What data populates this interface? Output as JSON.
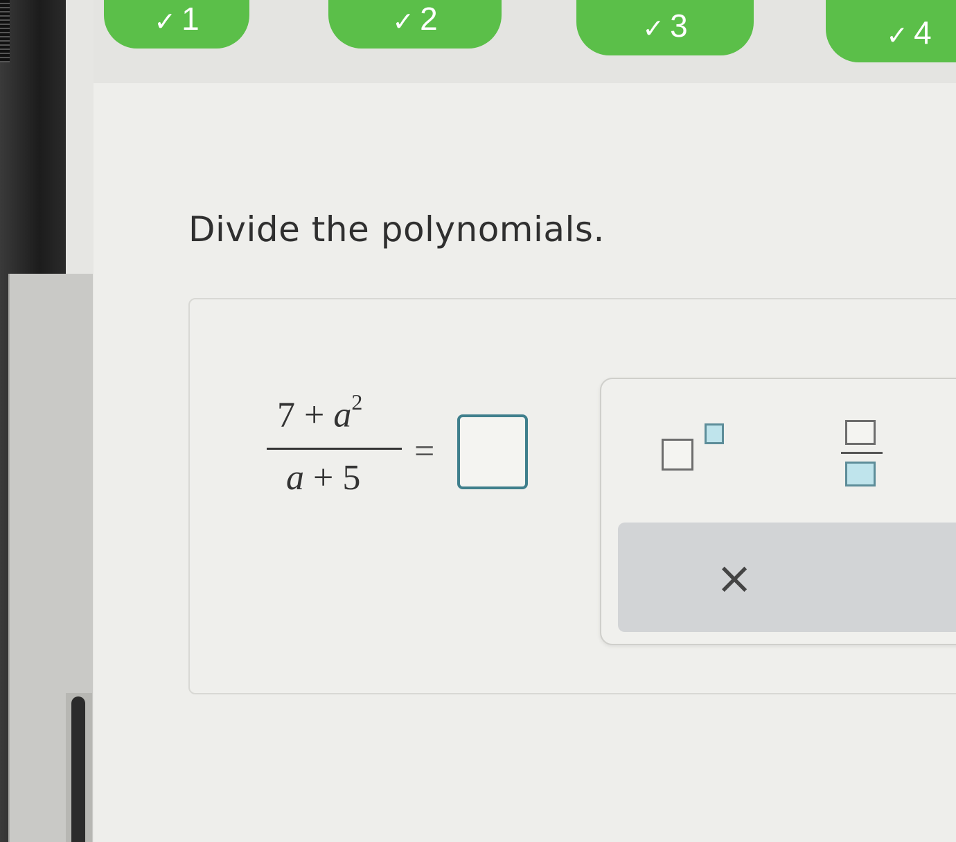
{
  "progress_steps": [
    {
      "label": "1",
      "status": "complete",
      "icon": "checkmark-icon"
    },
    {
      "label": "2",
      "status": "complete",
      "icon": "checkmark-icon"
    },
    {
      "label": "3",
      "status": "complete",
      "icon": "checkmark-icon"
    },
    {
      "label": "4",
      "status": "complete",
      "icon": "checkmark-icon"
    }
  ],
  "colors": {
    "step_complete": "#5bbf49",
    "input_border": "#3f7f8c",
    "placeholder_fill": "#bfe4ec"
  },
  "question": {
    "prompt": "Divide the polynomials.",
    "expression": {
      "numerator_constant": "7",
      "numerator_operator": "+",
      "numerator_variable": "a",
      "numerator_exponent": "2",
      "denominator_variable": "a",
      "denominator_operator": "+",
      "denominator_constant": "5",
      "equals": "="
    },
    "answer_value": ""
  },
  "keypad": {
    "keys": [
      {
        "name": "exponent-key",
        "icon": "superscript-template-icon"
      },
      {
        "name": "fraction-key",
        "icon": "fraction-template-icon"
      }
    ],
    "clear_symbol": "×"
  }
}
